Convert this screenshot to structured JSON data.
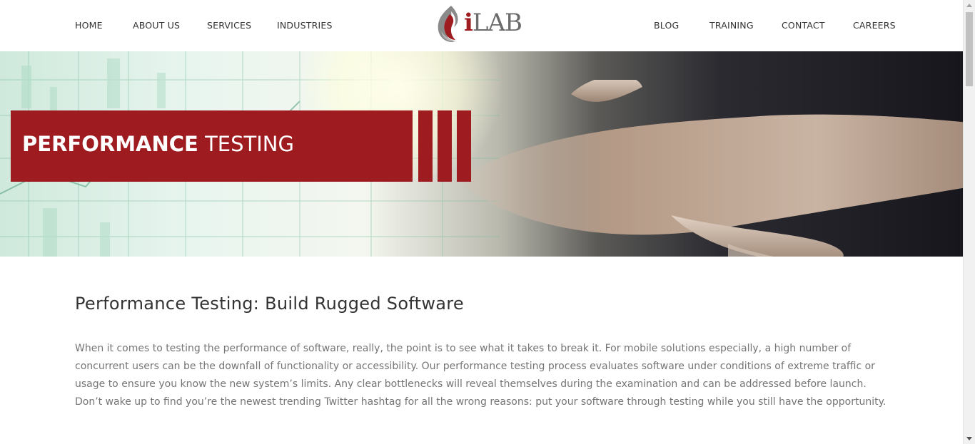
{
  "nav": {
    "left": [
      {
        "label": "HOME"
      },
      {
        "label": "ABOUT US"
      },
      {
        "label": "SERVICES"
      },
      {
        "label": "INDUSTRIES"
      }
    ],
    "right": [
      {
        "label": "BLOG"
      },
      {
        "label": "TRAINING"
      },
      {
        "label": "CONTACT"
      },
      {
        "label": "CAREERS"
      }
    ]
  },
  "logo": {
    "prefix": "i",
    "suffix": "LAB",
    "icon": "flame-icon"
  },
  "hero": {
    "title_bold": "PERFORMANCE",
    "title_light": "TESTING",
    "accent_color": "#9e1b20"
  },
  "content": {
    "heading": "Performance Testing: Build Rugged Software",
    "paragraph": "When it comes to testing the performance of software, really, the point is to see what it takes to break it. For mobile solutions especially, a high number of concurrent users can be the downfall of functionality or accessibility. Our performance testing process evaluates software under conditions of extreme traffic or usage to ensure you know the new system’s limits. Any clear bottlenecks will reveal themselves during the examination and can be addressed before launch. Don’t wake up to find you’re the newest trending Twitter hashtag for all the wrong reasons: put your software through testing while you still have the opportunity."
  }
}
